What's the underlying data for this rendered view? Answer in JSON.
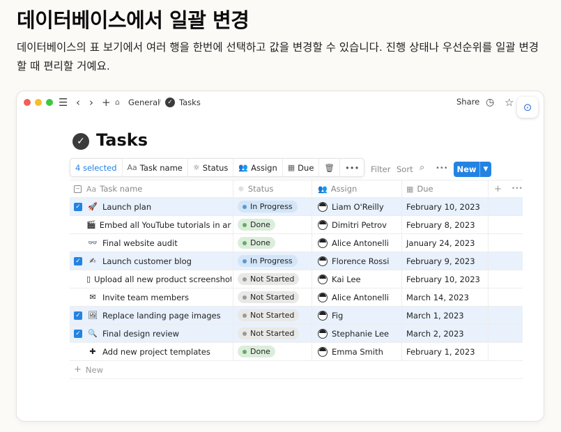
{
  "heading": "데이터베이스에서 일괄 변경",
  "description": "데이터베이스의 표 보기에서 여러 행을 한번에 선택하고 값을 변경할 수 있습니다. 진행 상태나 우선순위를 일괄 변경할 때 편리할 거예요.",
  "window": {
    "breadcrumb": {
      "workspace": "General",
      "separator": "/",
      "page": "Tasks"
    },
    "share_label": "Share"
  },
  "page": {
    "title": "Tasks"
  },
  "selection_bar": {
    "count_label": "4 selected",
    "task_name": "Task name",
    "status": "Status",
    "assign": "Assign",
    "due": "Due"
  },
  "toolbar": {
    "filter": "Filter",
    "sort": "Sort",
    "new_label": "New"
  },
  "table": {
    "columns": [
      "Task name",
      "Status",
      "Assign",
      "Due"
    ],
    "rows": [
      {
        "selected": true,
        "emoji": "🚀",
        "name": "Launch plan",
        "status": "In Progress",
        "assignee": "Liam O'Reilly",
        "due": "February 10, 2023"
      },
      {
        "selected": false,
        "emoji": "🎬",
        "name": "Embed all YouTube tutorials in article",
        "status": "Done",
        "assignee": "Dimitri Petrov",
        "due": "February 8, 2023"
      },
      {
        "selected": false,
        "emoji": "👓",
        "name": "Final website audit",
        "status": "Done",
        "assignee": "Alice Antonelli",
        "due": "January 24, 2023"
      },
      {
        "selected": true,
        "emoji": "✍",
        "name": "Launch customer blog",
        "status": "In Progress",
        "assignee": "Florence Rossi",
        "due": "February 9, 2023"
      },
      {
        "selected": false,
        "emoji": "▯",
        "name": "Upload all new product screenshots",
        "status": "Not Started",
        "assignee": "Kai Lee",
        "due": "February 10, 2023"
      },
      {
        "selected": false,
        "emoji": "✉",
        "name": "Invite team members",
        "status": "Not Started",
        "assignee": "Alice Antonelli",
        "due": "March 14, 2023"
      },
      {
        "selected": true,
        "emoji": "🖼",
        "name": "Replace landing page images",
        "status": "Not Started",
        "assignee": "Fig",
        "due": "March 1, 2023"
      },
      {
        "selected": true,
        "emoji": "🔍",
        "name": "Final design review",
        "status": "Not Started",
        "assignee": "Stephanie Lee",
        "due": "March 2, 2023"
      },
      {
        "selected": false,
        "emoji": "✚",
        "name": "Add new project templates",
        "status": "Done",
        "assignee": "Emma Smith",
        "due": "February 1, 2023"
      }
    ],
    "new_row_label": "New"
  },
  "status_colors": {
    "In Progress": {
      "bg": "#d3e5f7",
      "dot": "#5b97d3"
    },
    "Done": {
      "bg": "#dbeddb",
      "dot": "#6aa86a"
    },
    "Not Started": {
      "bg": "#e8e8e6",
      "dot": "#9b9a97"
    }
  }
}
